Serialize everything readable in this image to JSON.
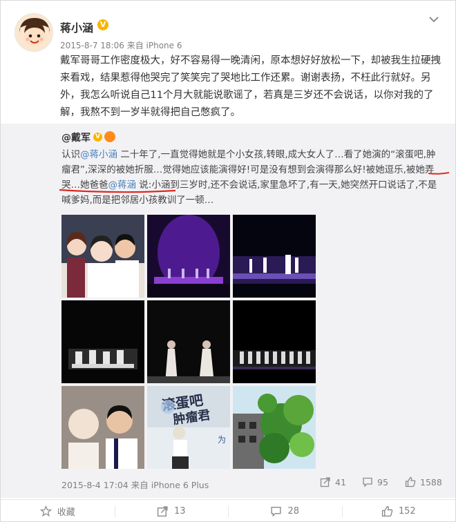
{
  "post": {
    "username": "蒋小涵",
    "verified_mark": "V",
    "timestamp": "2015-8-7 18:06",
    "source": "来自 iPhone 6",
    "text": "戴军哥哥工作密度极大，好不容易得一晚清闲，原本想好好放松一下，却被我生拉硬拽来看戏，结果惹得他哭完了笑笑完了哭地比工作还累。谢谢表扬，不枉此行就好。另外，我怎么听说自己11个月大就能说歌谣了，若真是三岁还不会说话，以你对我的了解，我熬不到一岁半就得把自己憋疯了。"
  },
  "repost": {
    "username": "@戴军",
    "verified_mark": "V",
    "text_parts": [
      "认识",
      "@蒋小涵",
      " 二十年了,一直觉得她就是个小女孩,转眼,成大女人了…看了她演的“滚蛋吧,肿瘤君”,深深的被她折服…觉得她应该能演得好!可是没有想到会演得那么好!被她逗乐,被她弄哭…她爸爸",
      "@蒋涵",
      " 说:小涵到三岁时,还不会说话,家里急坏了,有一天,她突然开口说话了,不是喊爹妈,而是把邻居小孩教训了一顿…"
    ],
    "timestamp": "2015-8-4 17:04",
    "source": "来自 iPhone 6 Plus",
    "stats": {
      "reposts": "41",
      "comments": "95",
      "likes": "1588"
    },
    "photo9_sign": "为"
  },
  "footer": {
    "favorite": "收藏",
    "repost": "13",
    "comment": "28",
    "like": "152"
  },
  "colors": {
    "link": "#4a7fb8",
    "meta": "#808080",
    "verified": "#f7b500",
    "underline": "#e0261f"
  }
}
